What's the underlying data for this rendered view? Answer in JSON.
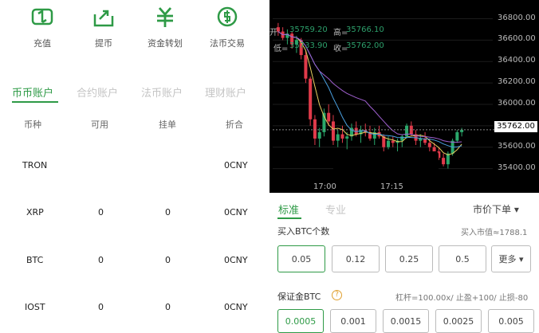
{
  "actions": [
    {
      "label": "充值",
      "icon": "deposit-icon"
    },
    {
      "label": "提币",
      "icon": "withdraw-icon"
    },
    {
      "label": "资金转划",
      "icon": "transfer-icon"
    },
    {
      "label": "法币交易",
      "icon": "fiat-trade-icon"
    }
  ],
  "account_tabs": [
    "币币账户",
    "合约账户",
    "法币账户",
    "理财账户"
  ],
  "table": {
    "headers": [
      "币种",
      "可用",
      "挂单",
      "折合"
    ],
    "rows": [
      {
        "coin": "TRON",
        "available": "",
        "orders": "",
        "value": "0CNY"
      },
      {
        "coin": "XRP",
        "available": "0",
        "orders": "0",
        "value": "0CNY"
      },
      {
        "coin": "BTC",
        "available": "0",
        "orders": "0",
        "value": "0CNY"
      },
      {
        "coin": "IOST",
        "available": "0",
        "orders": "0",
        "value": "0CNY"
      }
    ]
  },
  "chart": {
    "ohlc_open": "开",
    "open": "35759.20",
    "high_label": "高=",
    "high": "35766.10",
    "low_label": "低=",
    "low": "35733.90",
    "close_label": "收=",
    "close": "35762.00",
    "current_price": "35762.00",
    "y_ticks": [
      "36800.00",
      "36600.00",
      "36400.00",
      "36200.00",
      "36000.00",
      "35800.00",
      "35600.00",
      "35400.00"
    ],
    "x_ticks": [
      "17:00",
      "17:15"
    ]
  },
  "chart_data": {
    "type": "candlestick",
    "ylim": [
      35300,
      36900
    ],
    "candles": [
      {
        "o": 36720,
        "h": 36760,
        "l": 36640,
        "c": 36680
      },
      {
        "o": 36680,
        "h": 36720,
        "l": 36600,
        "c": 36620
      },
      {
        "o": 36620,
        "h": 36700,
        "l": 36560,
        "c": 36660
      },
      {
        "o": 36660,
        "h": 36680,
        "l": 36520,
        "c": 36560
      },
      {
        "o": 36560,
        "h": 36640,
        "l": 36480,
        "c": 36600
      },
      {
        "o": 36600,
        "h": 36620,
        "l": 36420,
        "c": 36460
      },
      {
        "o": 36460,
        "h": 36500,
        "l": 36200,
        "c": 36240
      },
      {
        "o": 36240,
        "h": 36260,
        "l": 35800,
        "c": 35860
      },
      {
        "o": 35860,
        "h": 35900,
        "l": 35620,
        "c": 35680
      },
      {
        "o": 35680,
        "h": 35780,
        "l": 35600,
        "c": 35740
      },
      {
        "o": 35740,
        "h": 35960,
        "l": 35700,
        "c": 35920
      },
      {
        "o": 35920,
        "h": 36000,
        "l": 35800,
        "c": 35840
      },
      {
        "o": 35840,
        "h": 35900,
        "l": 35620,
        "c": 35660
      },
      {
        "o": 35660,
        "h": 35760,
        "l": 35600,
        "c": 35720
      },
      {
        "o": 35720,
        "h": 35800,
        "l": 35640,
        "c": 35680
      },
      {
        "o": 35680,
        "h": 35740,
        "l": 35580,
        "c": 35700
      },
      {
        "o": 35700,
        "h": 35820,
        "l": 35660,
        "c": 35780
      },
      {
        "o": 35780,
        "h": 35840,
        "l": 35700,
        "c": 35720
      },
      {
        "o": 35720,
        "h": 35800,
        "l": 35640,
        "c": 35760
      },
      {
        "o": 35760,
        "h": 35820,
        "l": 35700,
        "c": 35740
      },
      {
        "o": 35740,
        "h": 35800,
        "l": 35660,
        "c": 35680
      },
      {
        "o": 35680,
        "h": 35780,
        "l": 35620,
        "c": 35740
      },
      {
        "o": 35740,
        "h": 35800,
        "l": 35680,
        "c": 35700
      },
      {
        "o": 35700,
        "h": 35720,
        "l": 35560,
        "c": 35600
      },
      {
        "o": 35600,
        "h": 35700,
        "l": 35580,
        "c": 35660
      },
      {
        "o": 35660,
        "h": 35700,
        "l": 35600,
        "c": 35640
      },
      {
        "o": 35640,
        "h": 35680,
        "l": 35560,
        "c": 35660
      },
      {
        "o": 35660,
        "h": 35720,
        "l": 35600,
        "c": 35700
      },
      {
        "o": 35700,
        "h": 35820,
        "l": 35680,
        "c": 35800
      },
      {
        "o": 35800,
        "h": 35840,
        "l": 35700,
        "c": 35720
      },
      {
        "o": 35720,
        "h": 35760,
        "l": 35620,
        "c": 35660
      },
      {
        "o": 35660,
        "h": 35720,
        "l": 35600,
        "c": 35680
      },
      {
        "o": 35680,
        "h": 35740,
        "l": 35620,
        "c": 35640
      },
      {
        "o": 35640,
        "h": 35680,
        "l": 35560,
        "c": 35600
      },
      {
        "o": 35600,
        "h": 35640,
        "l": 35540,
        "c": 35560
      },
      {
        "o": 35560,
        "h": 35600,
        "l": 35480,
        "c": 35500
      },
      {
        "o": 35500,
        "h": 35540,
        "l": 35420,
        "c": 35440
      },
      {
        "o": 35440,
        "h": 35560,
        "l": 35400,
        "c": 35540
      },
      {
        "o": 35540,
        "h": 35680,
        "l": 35520,
        "c": 35660
      },
      {
        "o": 35660,
        "h": 35760,
        "l": 35640,
        "c": 35740
      },
      {
        "o": 35740,
        "h": 35780,
        "l": 35700,
        "c": 35762
      }
    ]
  },
  "trade": {
    "tabs": [
      "标准",
      "专业"
    ],
    "order_type": "市价下单 ▾",
    "buy_label": "买入BTC个数",
    "buy_value": "买入市值≈1788.1",
    "quantities": [
      "0.05",
      "0.12",
      "0.25",
      "0.5"
    ],
    "more": "更多 ▾",
    "margin_label": "保证金BTC",
    "margin_info": "杠杆=100.00x/ 止盈+100/ 止损-80",
    "margins": [
      "0.0005",
      "0.001",
      "0.0015",
      "0.0025",
      "0.005"
    ]
  },
  "colors": {
    "accent": "#2e9a46",
    "up": "#2aa86b",
    "down": "#e03a4a"
  }
}
